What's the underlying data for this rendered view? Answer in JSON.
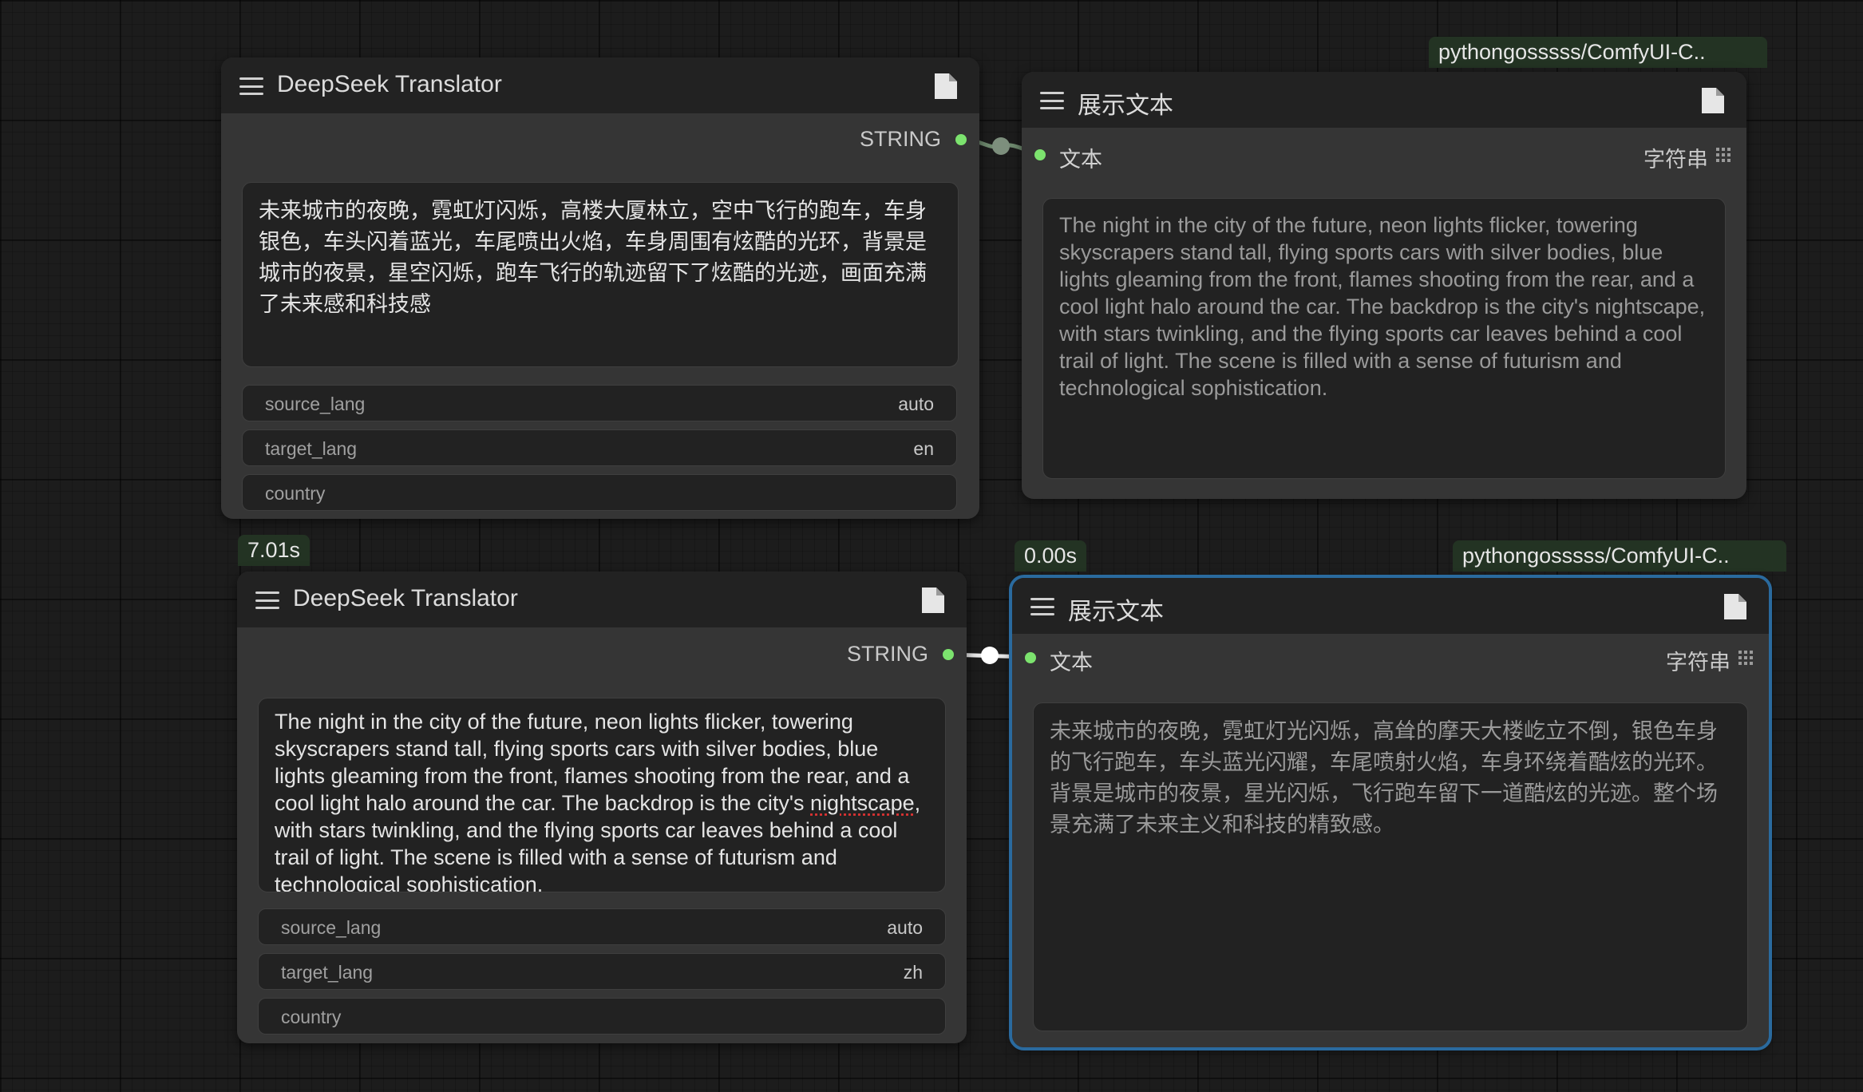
{
  "colors": {
    "background": "#1c1c1c",
    "node_body": "#353535",
    "node_header": "#222222",
    "slot_string": "#7ce36e",
    "selection": "#2a6a9e",
    "badge_bg": "#233323"
  },
  "nodes": {
    "translator_top": {
      "title": "DeepSeek Translator",
      "output_label": "STRING",
      "text": "未来城市的夜晚，霓虹灯闪烁，高楼大厦林立，空中飞行的跑车，车身银色，车头闪着蓝光，车尾喷出火焰，车身周围有炫酷的光环，背景是城市的夜景，星空闪烁，跑车飞行的轨迹留下了炫酷的光迹，画面充满了未来感和科技感",
      "widgets": [
        {
          "label": "source_lang",
          "value": "auto"
        },
        {
          "label": "target_lang",
          "value": "en"
        },
        {
          "label": "country",
          "value": ""
        }
      ]
    },
    "show_text_top": {
      "badge": "pythongosssss/ComfyUI-C..",
      "title": "展示文本",
      "input_label": "文本",
      "type_label": "字符串",
      "text": "The night in the city of the future, neon lights flicker, towering skyscrapers stand tall, flying sports cars with silver bodies, blue lights gleaming from the front, flames shooting from the rear, and a cool light halo around the car. The backdrop is the city's nightscape, with stars twinkling, and the flying sports car leaves behind a cool trail of light. The scene is filled with a sense of futurism and technological sophistication."
    },
    "translator_bottom": {
      "badge": "7.01s",
      "title": "DeepSeek Translator",
      "output_label": "STRING",
      "text_before": "The night in the city of the future, neon lights flicker, towering skyscrapers stand tall, flying sports cars with silver bodies, blue lights gleaming from the front, flames shooting from the rear, and a cool light halo around the car. The backdrop is the city's ",
      "text_misspelled": "nightscape",
      "text_after": ", with stars twinkling, and the flying sports car leaves behind a cool trail of light. The scene is filled with a sense of futurism and technological sophistication.",
      "widgets": [
        {
          "label": "source_lang",
          "value": "auto"
        },
        {
          "label": "target_lang",
          "value": "zh"
        },
        {
          "label": "country",
          "value": ""
        }
      ]
    },
    "show_text_bottom": {
      "timing_badge": "0.00s",
      "badge": "pythongosssss/ComfyUI-C..",
      "title": "展示文本",
      "input_label": "文本",
      "type_label": "字符串",
      "text": "未来城市的夜晚，霓虹灯光闪烁，高耸的摩天大楼屹立不倒，银色车身的飞行跑车，车头蓝光闪耀，车尾喷射火焰，车身环绕着酷炫的光环。背景是城市的夜景，星光闪烁，飞行跑车留下一道酷炫的光迹。整个场景充满了未来主义和科技的精致感。"
    }
  }
}
